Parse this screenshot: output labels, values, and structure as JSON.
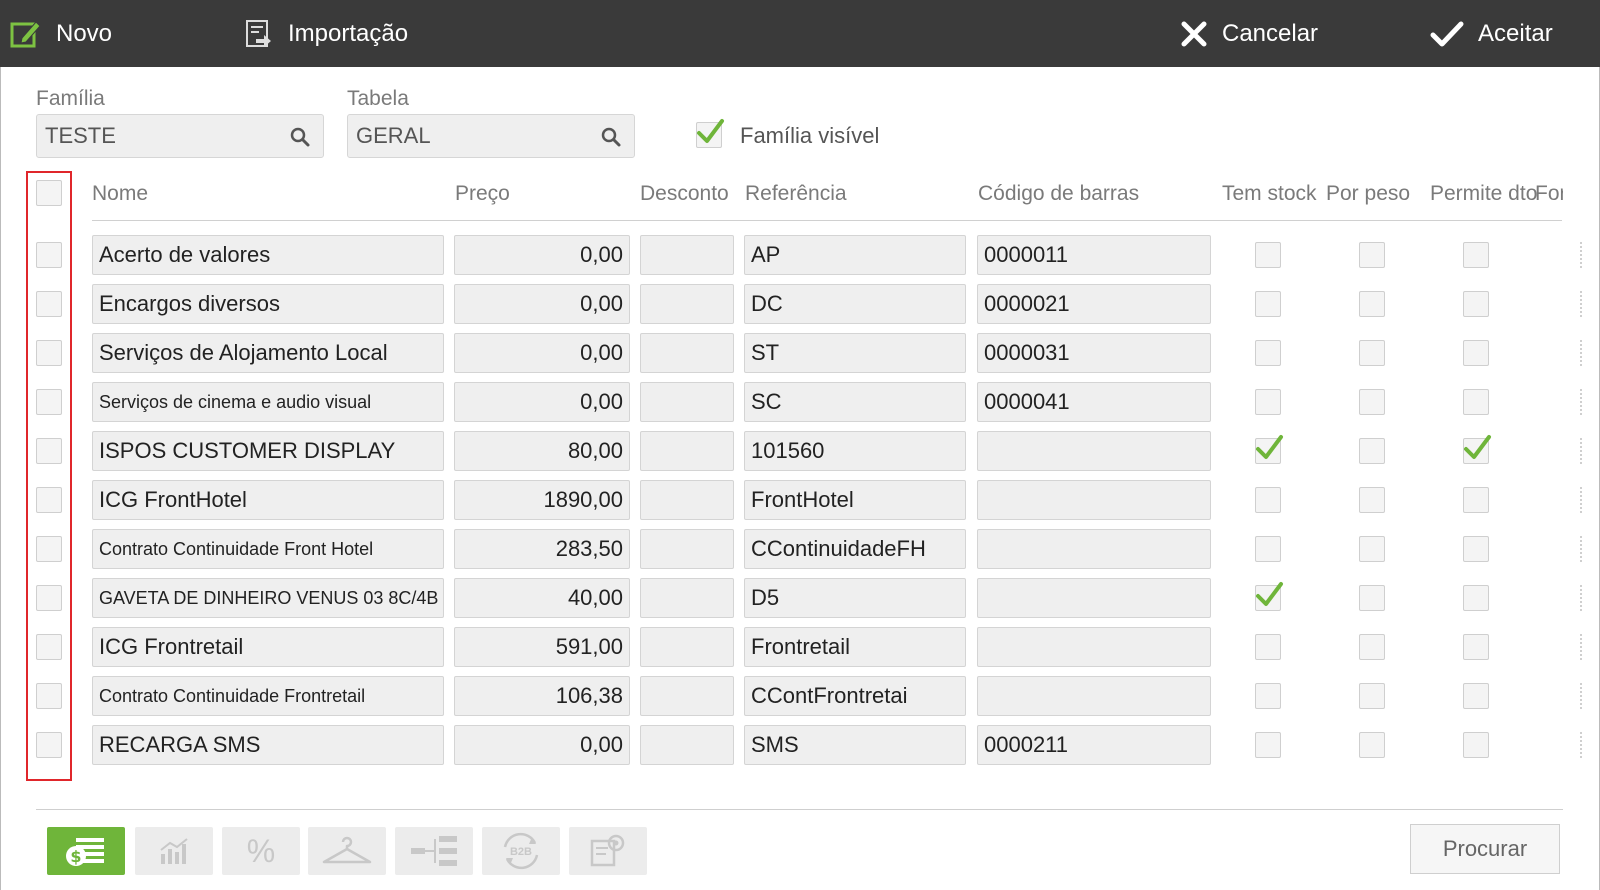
{
  "toolbar": {
    "novo_label": "Novo",
    "importacao_label": "Importação",
    "cancelar_label": "Cancelar",
    "aceitar_label": "Aceitar"
  },
  "filters": {
    "familia_label": "Família",
    "familia_value": "TESTE",
    "tabela_label": "Tabela",
    "tabela_value": "GERAL",
    "familia_visivel_label": "Família visível",
    "familia_visivel_checked": true
  },
  "table": {
    "headers": [
      "Nome",
      "Preço",
      "Desconto",
      "Referência",
      "Código de barras",
      "Tem stock",
      "Por peso",
      "Permite dto",
      "For"
    ],
    "rows": [
      {
        "nome": "Acerto de valores",
        "preco": "0,00",
        "desconto": "",
        "referencia": "AP",
        "codigo": "0000011",
        "tem_stock": false,
        "por_peso": false,
        "permite_dto": false
      },
      {
        "nome": "Encargos diversos",
        "preco": "0,00",
        "desconto": "",
        "referencia": "DC",
        "codigo": "0000021",
        "tem_stock": false,
        "por_peso": false,
        "permite_dto": false
      },
      {
        "nome": "Serviços de Alojamento Local",
        "preco": "0,00",
        "desconto": "",
        "referencia": "ST",
        "codigo": "0000031",
        "tem_stock": false,
        "por_peso": false,
        "permite_dto": false
      },
      {
        "nome": "Serviços de cinema e audio visual",
        "preco": "0,00",
        "desconto": "",
        "referencia": "SC",
        "codigo": "0000041",
        "tem_stock": false,
        "por_peso": false,
        "permite_dto": false
      },
      {
        "nome": "ISPOS CUSTOMER DISPLAY",
        "preco": "80,00",
        "desconto": "",
        "referencia": "101560",
        "codigo": "",
        "tem_stock": true,
        "por_peso": false,
        "permite_dto": true
      },
      {
        "nome": "ICG FrontHotel",
        "preco": "1890,00",
        "desconto": "",
        "referencia": "FrontHotel",
        "codigo": "",
        "tem_stock": false,
        "por_peso": false,
        "permite_dto": false
      },
      {
        "nome": "Contrato Continuidade Front Hotel",
        "preco": "283,50",
        "desconto": "",
        "referencia": "CContinuidadeFH",
        "codigo": "",
        "tem_stock": false,
        "por_peso": false,
        "permite_dto": false
      },
      {
        "nome": "GAVETA DE DINHEIRO VENUS 03 8C/4B",
        "preco": "40,00",
        "desconto": "",
        "referencia": "D5",
        "codigo": "",
        "tem_stock": true,
        "por_peso": false,
        "permite_dto": false
      },
      {
        "nome": "ICG Frontretail",
        "preco": "591,00",
        "desconto": "",
        "referencia": "Frontretail",
        "codigo": "",
        "tem_stock": false,
        "por_peso": false,
        "permite_dto": false
      },
      {
        "nome": "Contrato Continuidade Frontretail",
        "preco": "106,38",
        "desconto": "",
        "referencia": "CContFrontretai",
        "codigo": "",
        "tem_stock": false,
        "por_peso": false,
        "permite_dto": false
      },
      {
        "nome": "RECARGA SMS",
        "preco": "0,00",
        "desconto": "",
        "referencia": "SMS",
        "codigo": "0000211",
        "tem_stock": false,
        "por_peso": false,
        "permite_dto": false
      }
    ]
  },
  "bottom": {
    "buttons": [
      "price-icon",
      "chart-icon",
      "percent-icon",
      "hanger-icon",
      "hierarchy-icon",
      "b2b-icon",
      "settings-icon"
    ],
    "percent_label": "%",
    "b2b_label": "B2B",
    "procurar_label": "Procurar"
  },
  "colors": {
    "toolbar_bg": "#3a3a3a",
    "accent_green": "#6fb53a",
    "highlight_red": "#e0262b"
  }
}
